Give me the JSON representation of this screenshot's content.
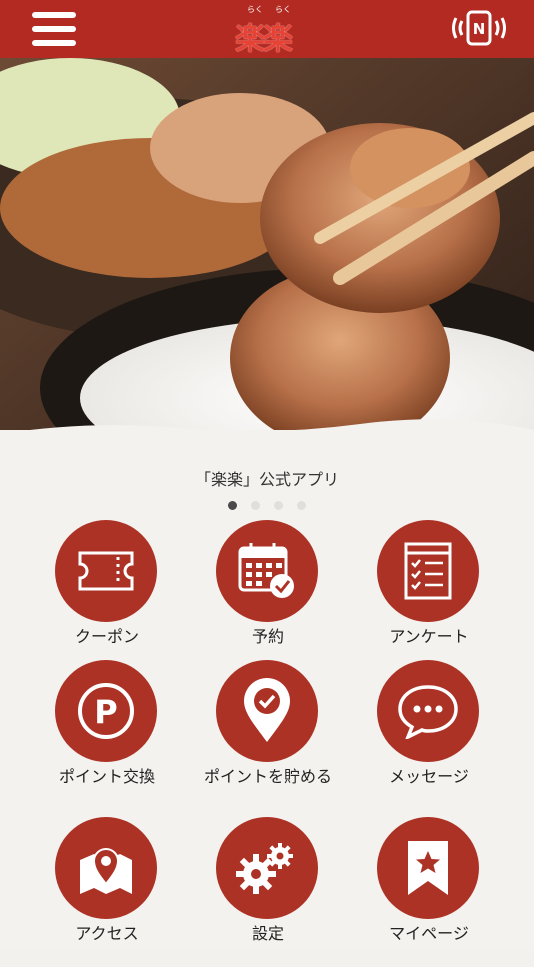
{
  "header": {
    "logo_ruby": [
      "らく",
      "らく"
    ],
    "logo_text": "楽楽",
    "menu_icon": "hamburger-menu-icon",
    "nfc_icon": "nfc-phone-icon"
  },
  "colors": {
    "brand": "#b32a22",
    "tile": "#ad3226",
    "background": "#f4f2ef"
  },
  "hero": {
    "image": "ginger-pork-over-rice-photo"
  },
  "app_title": "「楽楽」公式アプリ",
  "carousel": {
    "page_count": 4,
    "active_page": 1
  },
  "menu": [
    {
      "label": "クーポン",
      "icon": "ticket-icon"
    },
    {
      "label": "予約",
      "icon": "calendar-check-icon"
    },
    {
      "label": "アンケート",
      "icon": "checklist-icon"
    },
    {
      "label": "ポイント交換",
      "icon": "point-p-icon"
    },
    {
      "label": "ポイントを貯める",
      "icon": "location-check-icon"
    },
    {
      "label": "メッセージ",
      "icon": "speech-bubble-icon"
    },
    {
      "label": "アクセス",
      "icon": "map-pin-icon"
    },
    {
      "label": "設定",
      "icon": "gears-icon"
    },
    {
      "label": "マイページ",
      "icon": "bookmark-star-icon"
    }
  ]
}
